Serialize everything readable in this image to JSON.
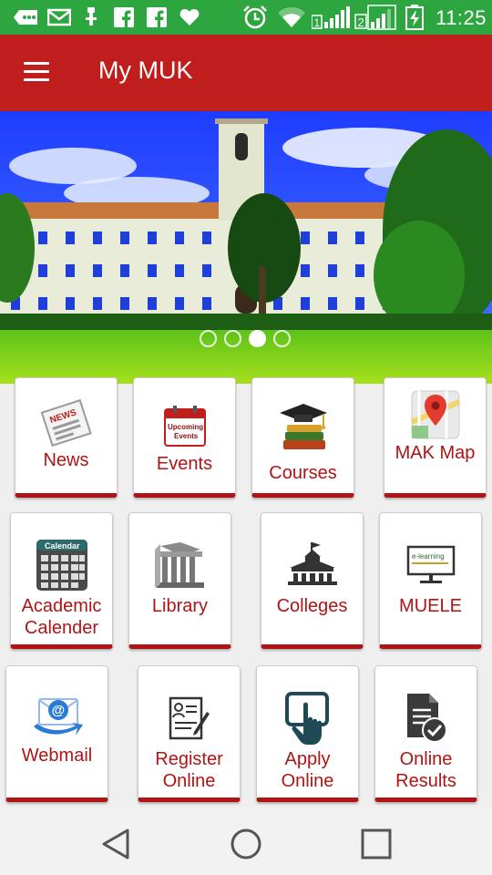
{
  "status_bar": {
    "time": "11:25",
    "left_icons": [
      "messaging-icon",
      "email-icon",
      "usb-icon",
      "facebook-icon",
      "facebook-icon",
      "heart-icon"
    ],
    "right_icons": [
      "alarm-icon",
      "wifi-icon",
      "signal-sim1-icon",
      "signal-sim2-icon",
      "battery-charging-icon"
    ],
    "sim1_label": "1",
    "sim2_label": "2"
  },
  "app_bar": {
    "title": "My MUK",
    "menu_icon": "hamburger-menu-icon"
  },
  "banner": {
    "slide_count": 4,
    "active_slide": 3
  },
  "tiles": [
    {
      "label": "News",
      "icon": "newspaper-icon",
      "badge": "NEWS"
    },
    {
      "label": "Events",
      "icon": "events-calendar-icon",
      "badge": "Upcoming Events"
    },
    {
      "label": "Courses",
      "icon": "graduation-cap-books-icon"
    },
    {
      "label": "MAK Map",
      "icon": "map-pin-icon"
    },
    {
      "label": "Academic Calender",
      "icon": "calendar-icon",
      "badge": "Calendar"
    },
    {
      "label": "Library",
      "icon": "library-building-icon"
    },
    {
      "label": "Colleges",
      "icon": "college-building-icon"
    },
    {
      "label": "MUELE",
      "icon": "elearning-screen-icon",
      "badge": "e-learning"
    },
    {
      "label": "Webmail",
      "icon": "email-at-icon"
    },
    {
      "label": "Register Online",
      "icon": "registration-form-icon"
    },
    {
      "label": "Apply Online",
      "icon": "tap-touch-icon"
    },
    {
      "label": "Online Results",
      "icon": "document-check-icon"
    }
  ],
  "nav_bar": {
    "back_icon": "back-triangle-icon",
    "home_icon": "home-circle-icon",
    "recents_icon": "recents-square-icon"
  },
  "colors": {
    "status_bar": "#2ea640",
    "app_bar": "#c01d1d",
    "tile_accent": "#b01414",
    "background": "#efefef"
  }
}
